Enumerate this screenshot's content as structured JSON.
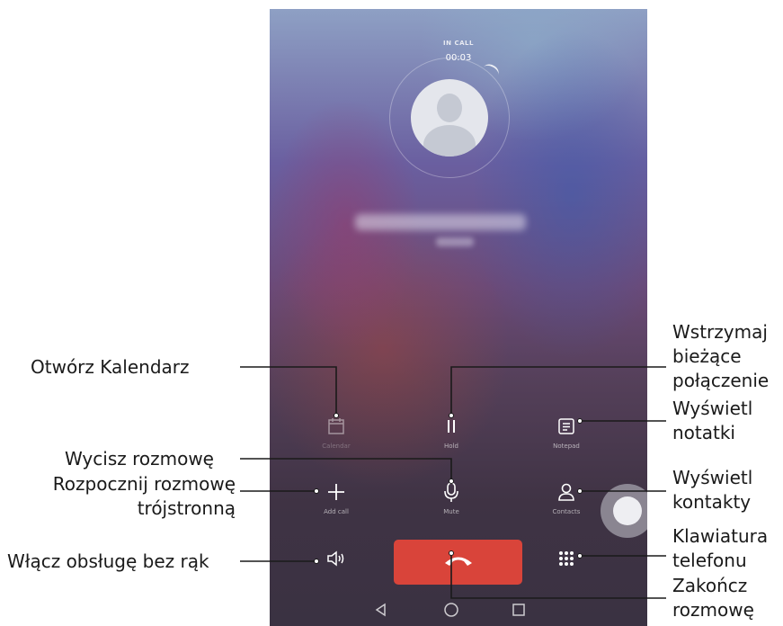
{
  "call_screen": {
    "status": "IN CALL",
    "timer": "00:03",
    "buttons": {
      "calendar": "Calendar",
      "hold": "Hold",
      "notepad": "Notepad",
      "add_call": "Add call",
      "mute": "Mute",
      "contacts": "Contacts"
    }
  },
  "callouts": {
    "calendar": "Otwórz Kalendarz",
    "hold": [
      "Wstrzymaj",
      "bieżące",
      "połączenie"
    ],
    "notes": [
      "Wyświetl",
      "notatki"
    ],
    "mute": "Wycisz rozmowę",
    "add_call": [
      "Rozpocznij rozmowę",
      "trójstronną"
    ],
    "contacts": [
      "Wyświetl",
      "kontakty"
    ],
    "speaker": "Włącz obsługę bez rąk",
    "keypad": [
      "Klawiatura",
      "telefonu"
    ],
    "end_call": [
      "Zakończ",
      "rozmowę"
    ]
  },
  "colors": {
    "end_call": "#d9443a",
    "callout_line": "#1a1a1a"
  },
  "icons": [
    "calendar-icon",
    "pause-icon",
    "note-icon",
    "plus-icon",
    "microphone-icon",
    "contact-icon",
    "speaker-icon",
    "keypad-icon",
    "phone-hangup-icon",
    "nav-back-icon",
    "nav-home-icon",
    "nav-recent-icon"
  ]
}
